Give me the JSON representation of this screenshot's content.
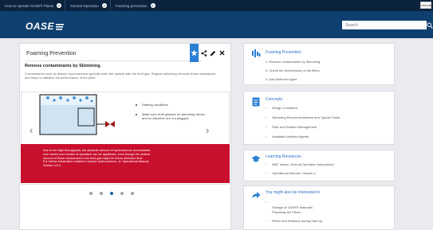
{
  "breadcrumbs": [
    {
      "label": "How to operate OASE® Plants"
    },
    {
      "label": "Normal Operation"
    },
    {
      "label": "Foaming prevention"
    }
  ],
  "user_box": "Username",
  "header": {
    "logo": "OASE",
    "search_placeholder": "Search"
  },
  "main": {
    "title": "Foaming Prevention",
    "subtitle": "Remove contaminants by Skimming.",
    "intro": "Contaminants such as heavier hydrocarbons typically enter the system with the feed gas. Regular skimming removes these substances and helps to stabilize the performance of the plant.",
    "bullets": [
      "Starting conditions",
      "Make sure level glasses on skimming device and on absorber are not plugged."
    ],
    "warning": [
      "Due to the high throughputs, the absolute amount of hydrocarbons accumulated",
      "over weeks and months of operation can be significant, even though the relative",
      "amount of these substances in the feed gas might be below detection limit.",
      "For further information related to heavier hydrocarbons, cf. Operational Manual,",
      "Section 4.5.1."
    ],
    "slide_count": 5,
    "active_slide": 2
  },
  "cards": {
    "foaming": {
      "title": "Foaming Prevention",
      "items": [
        "1. Remove contaminants by Skimming",
        "2. Check the performance of the filters",
        "3. Add Antifoam Agent"
      ]
    },
    "concepts": {
      "title": "Concepts",
      "items": [
        "Design Conditions",
        "Skimming Recommendations and Typical Faults",
        "Filter and Strainer Management",
        "Available Antifoam Agents"
      ]
    },
    "learning": {
      "title": "Learning Resources",
      "items": [
        "WBT lesson „Normal Operation Instructions“",
        "Operational Manual, Chapter 4"
      ]
    },
    "interest": {
      "title": "You might also be interested in",
      "items": [
        "Storage of OASE® Materials",
        "Preparing the Filters",
        "Filters and Strainers during Start-up"
      ]
    }
  },
  "colors": {
    "nav": "#0c2340",
    "header": "#0f3f6e",
    "accent": "#2a7fd4",
    "warning": "#c8102e",
    "valve": "#9b1b1b"
  }
}
